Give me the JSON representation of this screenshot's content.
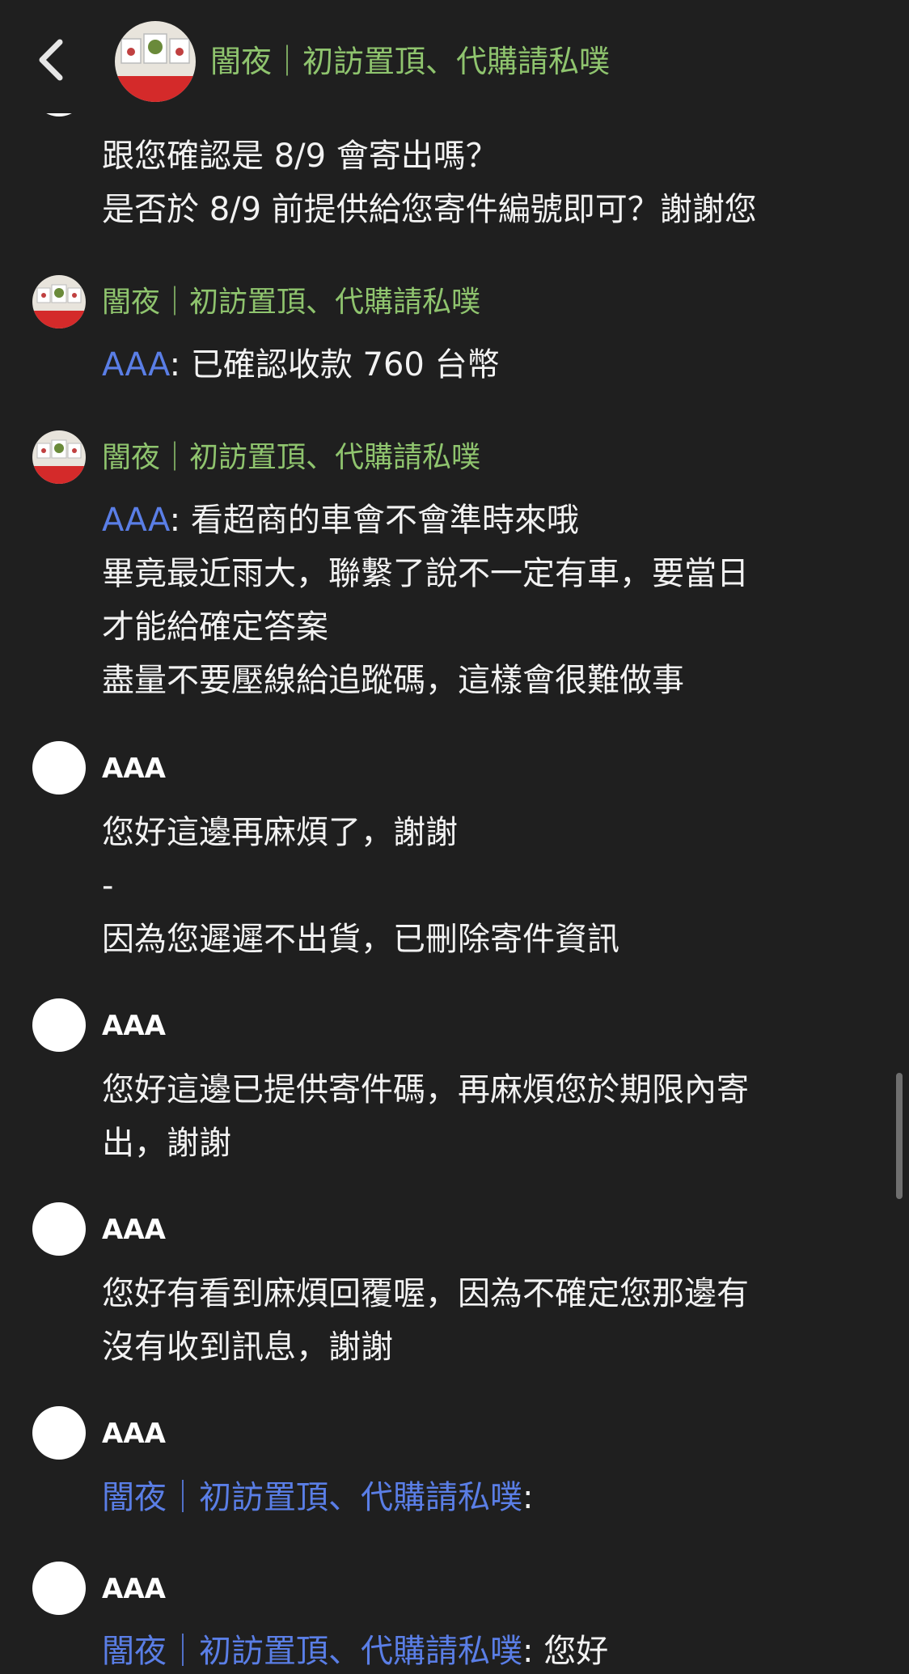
{
  "header": {
    "title": "闇夜｜初訪置頂、代購請私噗"
  },
  "messages": [
    {
      "text_lines": [
        "跟您確認是 8/9 會寄出嗎？",
        "是否於 8/9 前提供給您寄件編號即可？謝謝您"
      ]
    },
    {
      "sender": "闇夜｜初訪置頂、代購請私噗",
      "mention": "AAA",
      "text": ": 已確認收款 760 台幣"
    },
    {
      "sender": "闇夜｜初訪置頂、代購請私噗",
      "mention": "AAA",
      "text": ": 看超商的車會不會準時來哦",
      "text_lines": [
        "畢竟最近雨大，聯繫了說不一定有車，要當日",
        "才能給確定答案",
        "盡量不要壓線給追蹤碼，這樣會很難做事"
      ]
    },
    {
      "sender": "AAA",
      "text_lines": [
        "您好這邊再麻煩了，謝謝",
        "-",
        "因為您遲遲不出貨，已刪除寄件資訊"
      ]
    },
    {
      "sender": "AAA",
      "text_lines": [
        "您好這邊已提供寄件碼，再麻煩您於期限內寄",
        "出，謝謝"
      ]
    },
    {
      "sender": "AAA",
      "text_lines": [
        "您好有看到麻煩回覆喔，因為不確定您那邊有",
        "沒有收到訊息，謝謝"
      ]
    },
    {
      "sender": "AAA",
      "mention": "闇夜｜初訪置頂、代購請私噗",
      "text": ":"
    },
    {
      "sender": "AAA",
      "mention": "闇夜｜初訪置頂、代購請私噗",
      "text": ": 您好"
    }
  ],
  "colors": {
    "background": "#1f1f1f",
    "shop_name": "#8fc46e",
    "mention": "#5a7ee6",
    "text": "#f2f2f2"
  },
  "icons": {
    "back": "chevron-left-icon"
  }
}
